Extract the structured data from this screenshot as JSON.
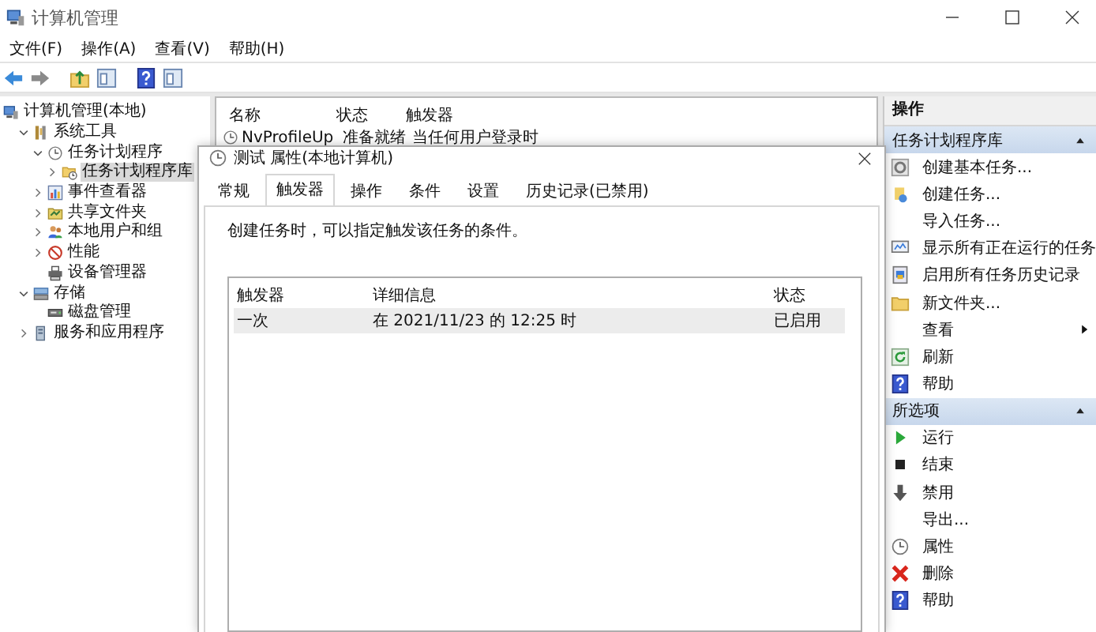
{
  "window": {
    "title": "计算机管理"
  },
  "menu": [
    "文件(F)",
    "操作(A)",
    "查看(V)",
    "帮助(H)"
  ],
  "tree": [
    {
      "label": "计算机管理(本地)",
      "selected": false,
      "children": [
        {
          "label": "系统工具",
          "expanded": true,
          "selected": false,
          "children": [
            {
              "label": "任务计划程序",
              "expanded": true,
              "selected": false,
              "children": [
                {
                  "label": "任务计划程序库",
                  "expanded": false,
                  "selected": true
                }
              ]
            },
            {
              "label": "事件查看器",
              "expanded": false,
              "selected": false
            },
            {
              "label": "共享文件夹",
              "expanded": false,
              "selected": false
            },
            {
              "label": "本地用户和组",
              "expanded": false,
              "selected": false
            },
            {
              "label": "性能",
              "expanded": false,
              "selected": false
            },
            {
              "label": "设备管理器",
              "selected": false
            }
          ]
        },
        {
          "label": "存储",
          "expanded": true,
          "selected": false,
          "children": [
            {
              "label": "磁盘管理",
              "selected": false
            }
          ]
        },
        {
          "label": "服务和应用程序",
          "expanded": false,
          "selected": false
        }
      ]
    }
  ],
  "task_list": {
    "columns": [
      "名称",
      "状态",
      "触发器"
    ],
    "rows": [
      {
        "cells": [
          "NvProfileUp",
          "准备就绪",
          "当任何用户登录时"
        ]
      }
    ]
  },
  "dialog": {
    "title": "测试 属性(本地计算机)",
    "tabs": [
      {
        "label": "常规",
        "selected": false
      },
      {
        "label": "触发器",
        "selected": true
      },
      {
        "label": "操作",
        "selected": false
      },
      {
        "label": "条件",
        "selected": false
      },
      {
        "label": "设置",
        "selected": false
      },
      {
        "label": "历史记录(已禁用)",
        "selected": false
      }
    ],
    "description": "创建任务时，可以指定触发该任务的条件。",
    "triggers": {
      "columns": [
        "触发器",
        "详细信息",
        "状态"
      ],
      "rows": [
        {
          "cells": [
            "一次",
            "在 2021/11/23 的 12:25 时",
            "已启用"
          ],
          "selected": true
        }
      ]
    }
  },
  "actions": {
    "title": "操作",
    "sections": [
      {
        "title": "任务计划程序库",
        "expanded": true,
        "items": [
          {
            "label": "创建基本任务...",
            "submenu": false
          },
          {
            "label": "创建任务...",
            "submenu": false
          },
          {
            "label": "导入任务...",
            "submenu": false
          },
          {
            "label": "显示所有正在运行的任务",
            "submenu": false
          },
          {
            "label": "启用所有任务历史记录",
            "submenu": false
          },
          {
            "label": "新文件夹...",
            "submenu": false
          },
          {
            "label": "查看",
            "submenu": true
          },
          {
            "label": "刷新",
            "submenu": false
          },
          {
            "label": "帮助",
            "submenu": false
          }
        ]
      },
      {
        "title": "所选项",
        "expanded": true,
        "items": [
          {
            "label": "运行",
            "submenu": false
          },
          {
            "label": "结束",
            "submenu": false
          },
          {
            "label": "禁用",
            "submenu": false
          },
          {
            "label": "导出...",
            "submenu": false
          },
          {
            "label": "属性",
            "submenu": false
          },
          {
            "label": "删除",
            "submenu": false
          },
          {
            "label": "帮助",
            "submenu": false
          }
        ]
      }
    ]
  }
}
